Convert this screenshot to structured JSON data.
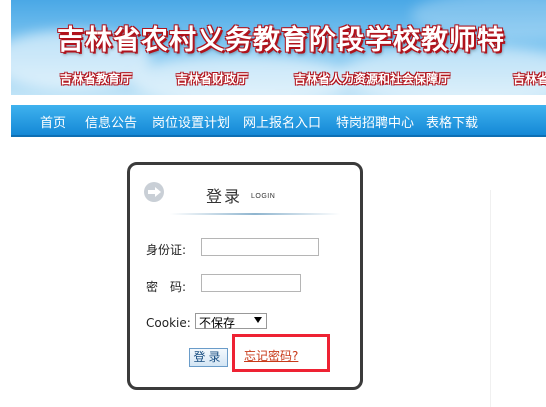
{
  "banner": {
    "title": "吉林省农村义务教育阶段学校教师特",
    "departments": [
      "吉林省教育厅",
      "吉林省财政厅",
      "吉林省人力资源和社会保障厅",
      "吉林省"
    ]
  },
  "nav": {
    "items": [
      "首页",
      "信息公告",
      "岗位设置计划",
      "网上报名入口",
      "特岗招聘中心",
      "表格下载"
    ]
  },
  "login": {
    "title": "登录",
    "subtitle": "LOGIN",
    "id_label": "身份证:",
    "id_value": "",
    "password_label": "密　码:",
    "password_value": "",
    "cookie_label": "Cookie:",
    "cookie_selected": "不保存",
    "submit_label": "登录",
    "forgot_label": "忘记密码?"
  },
  "colors": {
    "nav_bg": "#1488d6",
    "banner_title_outline": "#b0121b",
    "highlight_border": "#ee2233",
    "forgot_link": "#c83a1a"
  }
}
